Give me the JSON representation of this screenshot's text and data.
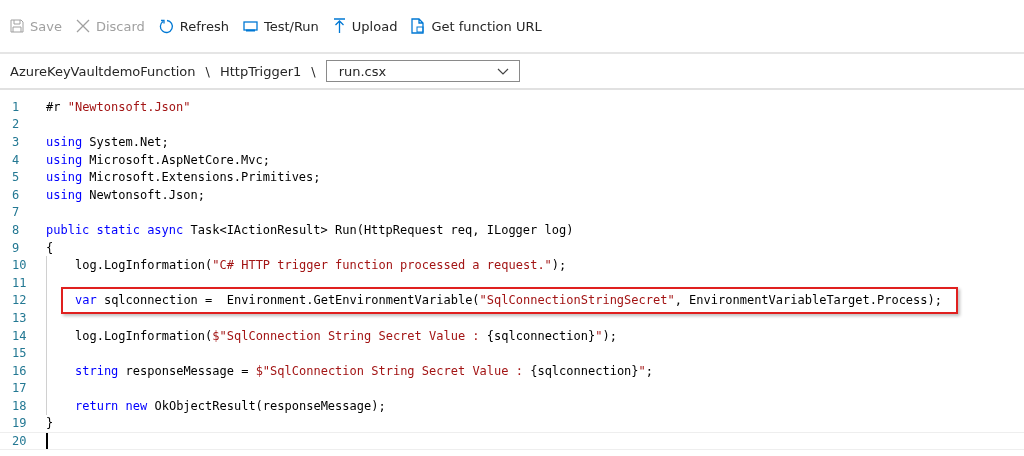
{
  "toolbar": [
    {
      "label": "Save",
      "disabled": true
    },
    {
      "label": "Discard",
      "disabled": true
    },
    {
      "label": "Refresh",
      "disabled": false
    },
    {
      "label": "Test/Run",
      "disabled": false
    },
    {
      "label": "Upload",
      "disabled": false
    },
    {
      "label": "Get function URL",
      "disabled": false
    }
  ],
  "breadcrumb": {
    "items": [
      {
        "label": "AzureKeyVaultdemoFunction",
        "separator": "\\"
      },
      {
        "label": "HttpTrigger1",
        "separator": "\\"
      }
    ],
    "file_select": {
      "value": "run.csx"
    }
  },
  "editor": {
    "lines": [
      {
        "number": "1",
        "tokens": [
          {
            "kind": "plain",
            "text": "#r "
          },
          {
            "kind": "str",
            "text": "\"Newtonsoft.Json\""
          }
        ]
      },
      {
        "number": "2"
      },
      {
        "number": "3",
        "tokens": [
          {
            "kind": "kw",
            "text": "using"
          },
          {
            "kind": "plain",
            "text": " System.Net;"
          }
        ]
      },
      {
        "number": "4",
        "tokens": [
          {
            "kind": "kw",
            "text": "using"
          },
          {
            "kind": "plain",
            "text": " Microsoft.AspNetCore.Mvc;"
          }
        ]
      },
      {
        "number": "5",
        "tokens": [
          {
            "kind": "kw",
            "text": "using"
          },
          {
            "kind": "plain",
            "text": " Microsoft.Extensions.Primitives;"
          }
        ]
      },
      {
        "number": "6",
        "tokens": [
          {
            "kind": "kw",
            "text": "using"
          },
          {
            "kind": "plain",
            "text": " Newtonsoft.Json;"
          }
        ]
      },
      {
        "number": "7"
      },
      {
        "number": "8",
        "tokens": [
          {
            "kind": "kw",
            "text": "public static async"
          },
          {
            "kind": "plain",
            "text": " Task<IActionResult> Run(HttpRequest req, ILogger log)"
          }
        ]
      },
      {
        "number": "9",
        "tokens": [
          {
            "kind": "plain",
            "text": "{"
          }
        ],
        "children": [
          {
            "number": "10",
            "tokens": [
              {
                "kind": "plain",
                "text": "log.LogInformation("
              },
              {
                "kind": "str",
                "text": "\"C# HTTP trigger function processed a request.\""
              },
              {
                "kind": "plain",
                "text": ");"
              }
            ]
          },
          {
            "number": "11"
          },
          {
            "number": "12",
            "highlighted": true,
            "tokens": [
              {
                "kind": "kw",
                "text": "var"
              },
              {
                "kind": "plain",
                "text": " sqlconnection =  Environment.GetEnvironmentVariable("
              },
              {
                "kind": "str",
                "text": "\"SqlConnectionStringSecret\""
              },
              {
                "kind": "plain",
                "text": ", EnvironmentVariableTarget.Process);"
              }
            ]
          },
          {
            "number": "13"
          },
          {
            "number": "14",
            "tokens": [
              {
                "kind": "plain",
                "text": "log.LogInformation("
              },
              {
                "kind": "str",
                "text": "$\"SqlConnection String Secret Value : "
              },
              {
                "kind": "plain",
                "text": "{sqlconnection}"
              },
              {
                "kind": "str",
                "text": "\""
              },
              {
                "kind": "plain",
                "text": ");"
              }
            ]
          },
          {
            "number": "15"
          },
          {
            "number": "16",
            "tokens": [
              {
                "kind": "kw",
                "text": "string"
              },
              {
                "kind": "plain",
                "text": " responseMessage = "
              },
              {
                "kind": "str",
                "text": "$\"SqlConnection String Secret Value : "
              },
              {
                "kind": "plain",
                "text": "{sqlconnection}"
              },
              {
                "kind": "str",
                "text": "\""
              },
              {
                "kind": "plain",
                "text": ";"
              }
            ]
          },
          {
            "number": "17"
          },
          {
            "number": "18",
            "tokens": [
              {
                "kind": "kw",
                "text": "return new"
              },
              {
                "kind": "plain",
                "text": " OkObjectResult(responseMessage);"
              }
            ]
          }
        ]
      },
      {
        "number": "19",
        "tokens": [
          {
            "kind": "plain",
            "text": "}"
          }
        ]
      },
      {
        "number": "20"
      }
    ]
  }
}
